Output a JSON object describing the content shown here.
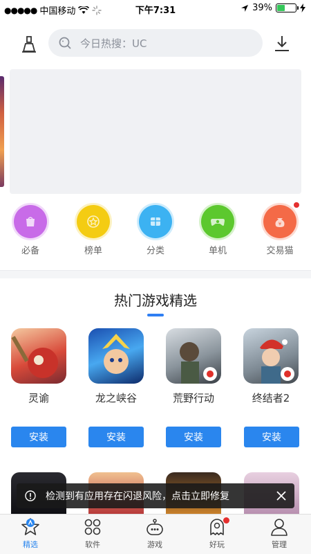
{
  "status_bar": {
    "signal": "●●●●●",
    "carrier": "中国移动",
    "time": "下午7:31",
    "battery_percent": "39%",
    "battery_level": 0.39
  },
  "header": {
    "search_placeholder": "今日热搜：UC",
    "clean_icon": "broom-icon",
    "download_icon": "download-icon"
  },
  "categories": [
    {
      "label": "必备",
      "color": "#c86be8",
      "icon": "bag-icon"
    },
    {
      "label": "榜单",
      "color": "#f5cc12",
      "icon": "star-icon"
    },
    {
      "label": "分类",
      "color": "#3db2f2",
      "icon": "grid-icon"
    },
    {
      "label": "单机",
      "color": "#5cc82e",
      "icon": "gamepad-icon"
    },
    {
      "label": "交易猫",
      "color": "#f46a47",
      "icon": "money-bag-icon",
      "badge": true
    }
  ],
  "section": {
    "title": "热门游戏精选"
  },
  "games": [
    {
      "name": "灵谕",
      "install_label": "安装"
    },
    {
      "name": "龙之峡谷",
      "install_label": "安装"
    },
    {
      "name": "荒野行动",
      "install_label": "安装"
    },
    {
      "name": "终结者2",
      "install_label": "安装"
    }
  ],
  "toast": {
    "message": "检测到有应用存在闪退风险，点击立即修复"
  },
  "tabs": [
    {
      "label": "精选",
      "icon": "star-icon",
      "active": true
    },
    {
      "label": "软件",
      "icon": "apps-icon"
    },
    {
      "label": "游戏",
      "icon": "gamepad-icon"
    },
    {
      "label": "好玩",
      "icon": "ghost-icon",
      "badge": true
    },
    {
      "label": "管理",
      "icon": "user-icon"
    }
  ],
  "colors": {
    "accent": "#2a86ee",
    "badge": "#e5302f"
  }
}
